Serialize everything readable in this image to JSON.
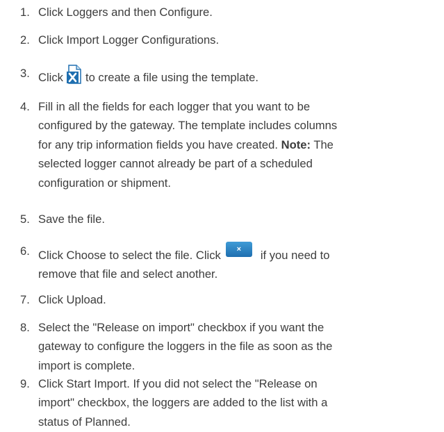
{
  "steps": [
    {
      "num": "1.",
      "text": "Click Loggers and then Configure."
    },
    {
      "num": "2.",
      "text": "Click Import Logger Configurations."
    },
    {
      "num": "3.",
      "text_before": "Click",
      "text_after": "to create a file using the template.",
      "icon": "excel-template-icon"
    },
    {
      "num": "4.",
      "line1": "Fill in all the fields for each logger that you want to be",
      "line2": "configured by the gateway. The template includes columns",
      "line3_a": "for any trip information fields you have created.",
      "line3_bold": "Note:",
      "line3_b": "The",
      "line4": "selected logger cannot already be part of a scheduled",
      "line5": "configuration or shipment."
    },
    {
      "num": "5.",
      "text": "Save the file."
    },
    {
      "num": "6.",
      "text_before": "Click Choose to select the file. Click",
      "text_after": "if you need to",
      "line2": "remove that file and select another.",
      "icon_label": "×",
      "icon": "remove-file-icon"
    },
    {
      "num": "7.",
      "text": "Click Upload."
    },
    {
      "num": "8.",
      "line1": "Select the \"Release on import\" checkbox if you want the",
      "line2": "gateway to configure the loggers in the file as soon as the",
      "line3": "import is complete."
    },
    {
      "num": "9.",
      "line1": "Click Start Import. If you did not select the \"Release on",
      "line2": "import\" checkbox, the loggers are added to the list with a",
      "line3": "status of Planned."
    }
  ],
  "colors": {
    "text": "#3d3d3d",
    "icon_blue": "#1f6fb0",
    "icon_blue_light": "#3f9bd6"
  }
}
